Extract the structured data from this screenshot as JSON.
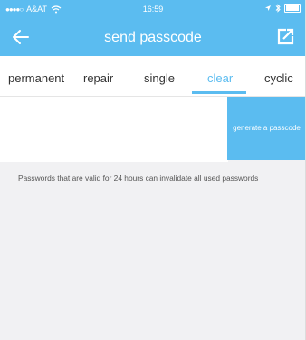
{
  "status_bar": {
    "carrier": "A&AT",
    "time": "16:59"
  },
  "header": {
    "title": "send passcode",
    "back_icon": "arrow-left-icon",
    "share_icon": "share-icon"
  },
  "tabs": [
    {
      "label": "permanent",
      "active": false
    },
    {
      "label": "repair",
      "active": false
    },
    {
      "label": "single",
      "active": false
    },
    {
      "label": "clear",
      "active": true
    },
    {
      "label": "cyclic",
      "active": false
    }
  ],
  "passcode_input": {
    "value": "",
    "placeholder": ""
  },
  "generate_button": {
    "label": "generate a passcode"
  },
  "note": "Passwords that are valid for 24 hours can invalidate all used passwords",
  "colors": {
    "accent": "#5bbcf0",
    "background": "#f1f1f3"
  }
}
